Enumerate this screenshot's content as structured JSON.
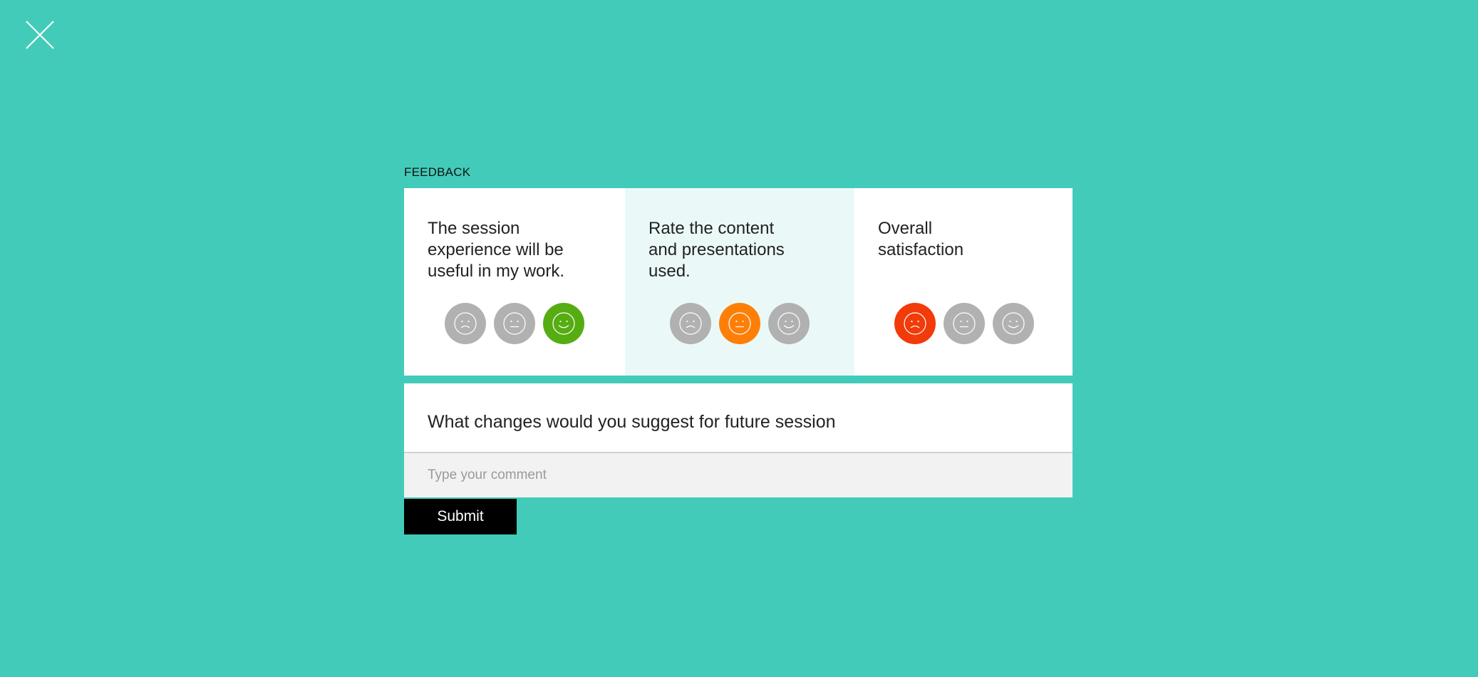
{
  "feedback": {
    "title": "FEEDBACK",
    "questions": [
      {
        "text": "The session\nexperience will be\nuseful in my work.",
        "faces": [
          {
            "icon": "sad-face-icon",
            "selected": false
          },
          {
            "icon": "neutral-face-icon",
            "selected": false
          },
          {
            "icon": "happy-face-icon",
            "selected": true,
            "color": "#55ad12"
          }
        ]
      },
      {
        "text": "Rate the content\nand presentations\nused.",
        "faces": [
          {
            "icon": "sad-face-icon",
            "selected": false
          },
          {
            "icon": "neutral-face-icon",
            "selected": true,
            "color": "#fe7f07"
          },
          {
            "icon": "happy-face-icon",
            "selected": false
          }
        ]
      },
      {
        "text": "Overall\nsatisfaction",
        "faces": [
          {
            "icon": "sad-face-icon",
            "selected": true,
            "color": "#f23b0a"
          },
          {
            "icon": "neutral-face-icon",
            "selected": false
          },
          {
            "icon": "happy-face-icon",
            "selected": false
          }
        ]
      }
    ],
    "comment": {
      "question": "What changes would you suggest for future session",
      "value": "",
      "placeholder": "Type your comment"
    },
    "submit_label": "Submit"
  },
  "icons": {
    "close": "close-icon"
  },
  "colors": {
    "background": "#43cbba",
    "unselected_face": "#b1b1b1",
    "highlight_column": "#eaf9f7"
  }
}
